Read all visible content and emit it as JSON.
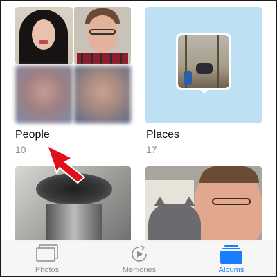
{
  "albums": [
    {
      "title": "People",
      "count": "10"
    },
    {
      "title": "Places",
      "count": "17"
    }
  ],
  "tabbar": {
    "photos_label": "Photos",
    "memories_label": "Memories",
    "albums_label": "Albums",
    "selected": "Albums"
  },
  "colors": {
    "accent": "#1a7cff",
    "arrow": "#e0101a",
    "places_bg": "#bde0f3",
    "inactive_tab": "#8e8e93"
  },
  "icons": {
    "photos": "photos-stack-icon",
    "memories": "memories-play-icon",
    "albums": "albums-stack-icon",
    "pointer": "red-arrow-icon"
  }
}
